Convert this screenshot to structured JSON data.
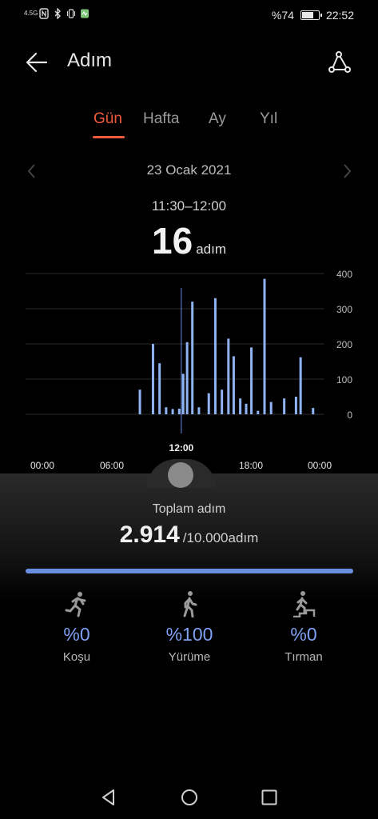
{
  "status_bar": {
    "network": "4.5G",
    "battery_text": "%74",
    "battery_level": 0.74,
    "time": "22:52"
  },
  "header": {
    "title": "Adım"
  },
  "tabs": [
    {
      "label": "Gün",
      "active": true
    },
    {
      "label": "Hafta",
      "active": false
    },
    {
      "label": "Ay",
      "active": false
    },
    {
      "label": "Yıl",
      "active": false
    }
  ],
  "date_nav": {
    "date": "23 Ocak 2021"
  },
  "selection": {
    "time_range": "11:30–12:00",
    "steps": "16",
    "unit": "adım"
  },
  "chart_data": {
    "type": "bar",
    "y_ticks": [
      "400",
      "300",
      "200",
      "100",
      "0"
    ],
    "ylim": [
      0,
      400
    ],
    "x_tick_labels": [
      "00:00",
      "06:00",
      "12:00",
      "18:00",
      "00:00"
    ],
    "selected_label": "12:00",
    "selected_slot": 23,
    "slot_count": 48,
    "bars": [
      {
        "slot": 17,
        "value": 70
      },
      {
        "slot": 19,
        "value": 200
      },
      {
        "slot": 20,
        "value": 145
      },
      {
        "slot": 21,
        "value": 20
      },
      {
        "slot": 22,
        "value": 15
      },
      {
        "slot": 23,
        "value": 16
      },
      {
        "slot": 23.6,
        "value": 115
      },
      {
        "slot": 24.2,
        "value": 205
      },
      {
        "slot": 25,
        "value": 320
      },
      {
        "slot": 26,
        "value": 20
      },
      {
        "slot": 27.5,
        "value": 60
      },
      {
        "slot": 28.5,
        "value": 330
      },
      {
        "slot": 29.5,
        "value": 70
      },
      {
        "slot": 30.5,
        "value": 215
      },
      {
        "slot": 31.3,
        "value": 165
      },
      {
        "slot": 32.3,
        "value": 45
      },
      {
        "slot": 33.2,
        "value": 30
      },
      {
        "slot": 34,
        "value": 190
      },
      {
        "slot": 35,
        "value": 10
      },
      {
        "slot": 36,
        "value": 385
      },
      {
        "slot": 37,
        "value": 35
      },
      {
        "slot": 39,
        "value": 45
      },
      {
        "slot": 40.8,
        "value": 50
      },
      {
        "slot": 41.5,
        "value": 162
      },
      {
        "slot": 43.4,
        "value": 18
      }
    ],
    "bar_color": "#8fb3f3"
  },
  "summary": {
    "total_label": "Toplam adım",
    "total_value": "2.914",
    "goal_text": "/10.000adım",
    "progress": 1.0
  },
  "activities": [
    {
      "icon": "running-icon",
      "percent": "%0",
      "label": "Koşu"
    },
    {
      "icon": "walking-icon",
      "percent": "%100",
      "label": "Yürüme"
    },
    {
      "icon": "climbing-icon",
      "percent": "%0",
      "label": "Tırman"
    }
  ],
  "colors": {
    "accent": "#f05a3c",
    "blue": "#7ea1f3"
  }
}
